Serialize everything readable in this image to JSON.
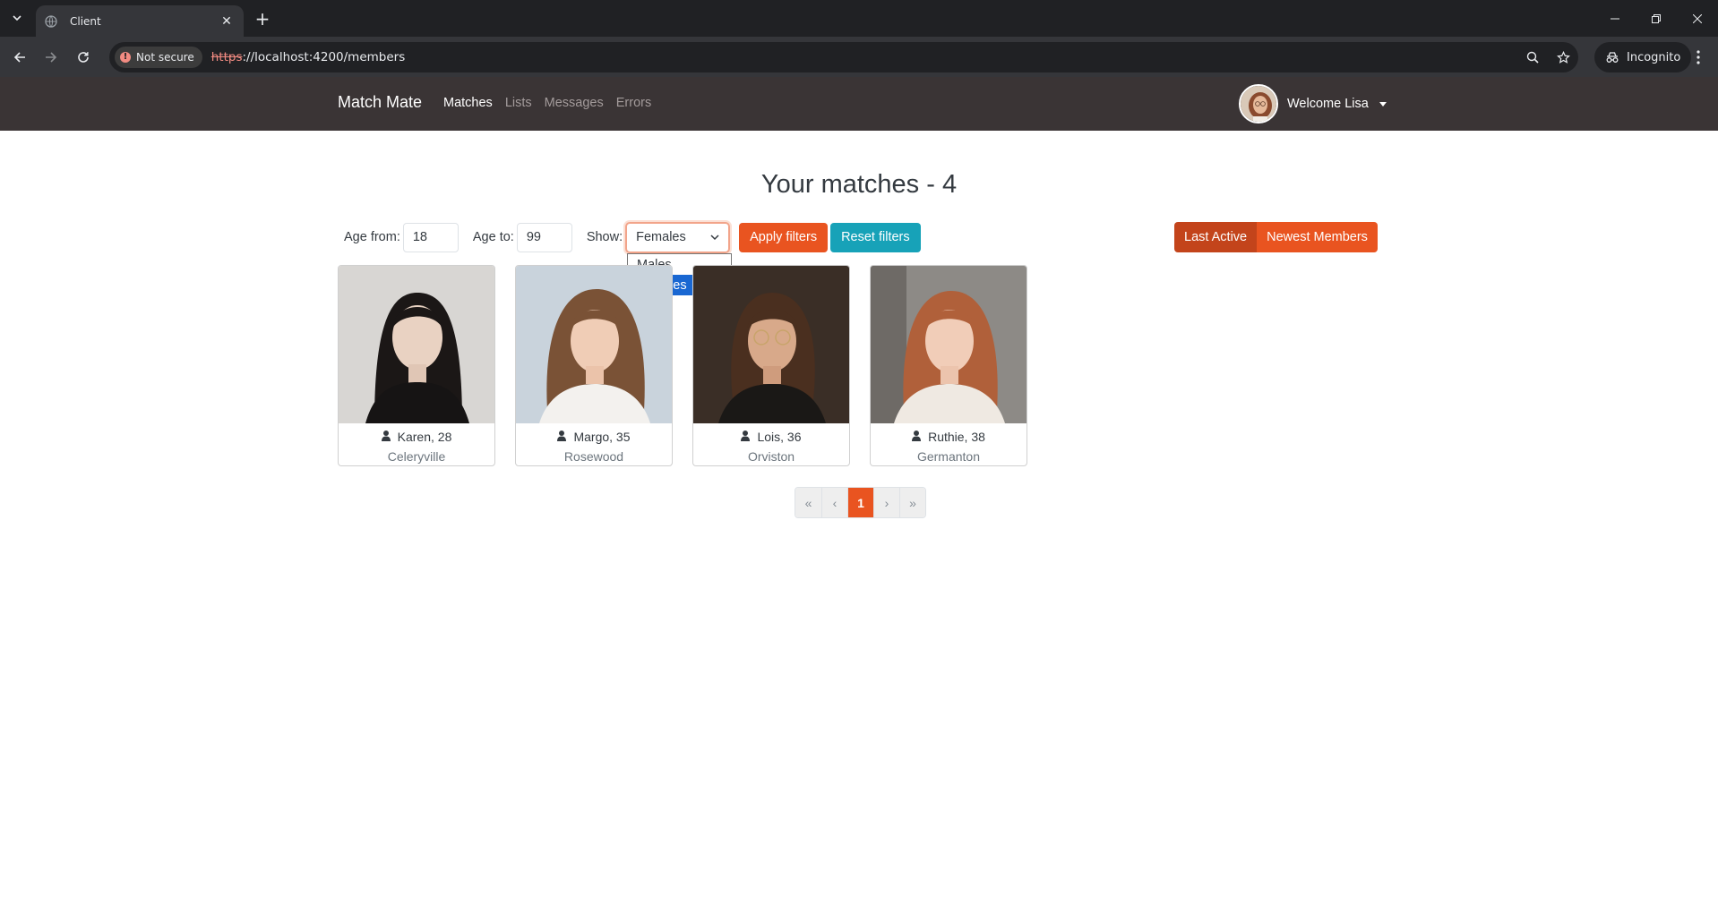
{
  "browser": {
    "tab_title": "Client",
    "security_label": "Not secure",
    "url_scheme": "https",
    "url_rest": "://localhost:4200/members",
    "incognito_label": "Incognito"
  },
  "navbar": {
    "brand": "Match Mate",
    "links": [
      "Matches",
      "Lists",
      "Messages",
      "Errors"
    ],
    "active_link": "Matches",
    "welcome": "Welcome Lisa"
  },
  "main": {
    "title": "Your matches - 4",
    "filters": {
      "age_from_label": "Age from:",
      "age_from_value": "18",
      "age_to_label": "Age to:",
      "age_to_value": "99",
      "show_label": "Show:",
      "show_selected": "Females",
      "show_options": [
        "Males",
        "Females"
      ],
      "apply_label": "Apply filters",
      "reset_label": "Reset filters"
    },
    "order_buttons": [
      "Last Active",
      "Newest Members"
    ],
    "members": [
      {
        "name": "Karen, 28",
        "city": "Celeryville"
      },
      {
        "name": "Margo, 35",
        "city": "Rosewood"
      },
      {
        "name": "Lois, 36",
        "city": "Orviston"
      },
      {
        "name": "Ruthie, 38",
        "city": "Germanton"
      }
    ],
    "pagination": [
      "«",
      "‹",
      "1",
      "›",
      "»"
    ],
    "current_page": "1"
  },
  "colors": {
    "primary": "#e95420",
    "info": "#17a2b8",
    "navbar": "#3a3435"
  }
}
